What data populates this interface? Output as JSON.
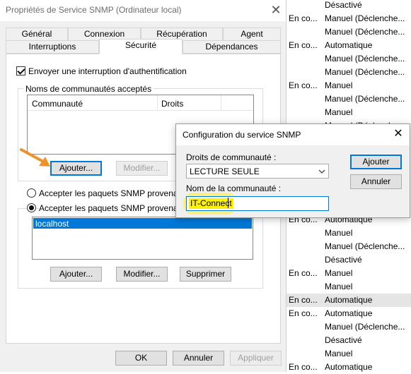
{
  "services": [
    {
      "status": "",
      "start": "Désactivé"
    },
    {
      "status": "En co...",
      "start": "Manuel (Déclenche..."
    },
    {
      "status": "",
      "start": "Manuel (Déclenche..."
    },
    {
      "status": "En co...",
      "start": "Automatique"
    },
    {
      "status": "",
      "start": "Manuel (Déclenche..."
    },
    {
      "status": "",
      "start": "Manuel (Déclenche..."
    },
    {
      "status": "En co...",
      "start": "Manuel"
    },
    {
      "status": "",
      "start": "Manuel (Déclenche..."
    },
    {
      "status": "",
      "start": "Manuel"
    },
    {
      "status": "",
      "start": "Manuel (Déclenche..."
    },
    {
      "status": "",
      "start": "Manuel (Déclenche..."
    },
    {
      "status": "",
      "start": "Manuel (Déclenche..."
    },
    {
      "status": "",
      "start": "Manuel (Déclenche..."
    },
    {
      "status": "",
      "start": "Manuel (Déclenche..."
    },
    {
      "status": "",
      "start": "Manuel (Déclenche..."
    },
    {
      "status": "",
      "start": "Manuel (Déclenche..."
    },
    {
      "status": "En co...",
      "start": "Automatique"
    },
    {
      "status": "",
      "start": "Manuel"
    },
    {
      "status": "",
      "start": "Manuel (Déclenche..."
    },
    {
      "status": "",
      "start": "Désactivé"
    },
    {
      "status": "En co...",
      "start": "Manuel"
    },
    {
      "status": "",
      "start": "Manuel"
    },
    {
      "status": "En co...",
      "start": "Automatique",
      "selected": true
    },
    {
      "status": "En co...",
      "start": "Automatique"
    },
    {
      "status": "",
      "start": "Manuel (Déclenche..."
    },
    {
      "status": "",
      "start": "Désactivé"
    },
    {
      "status": "",
      "start": "Manuel"
    },
    {
      "status": "En co...",
      "start": "Automatique"
    }
  ],
  "props": {
    "title": "Propriétés de Service SNMP (Ordinateur local)",
    "close_glyph": "✕",
    "tabs_row1": [
      "Général",
      "Connexion",
      "Récupération",
      "Agent"
    ],
    "tabs_row2": [
      "Interruptions",
      "Sécurité",
      "Dépendances"
    ],
    "active_tab": "Sécurité",
    "send_trap_label": "Envoyer une interruption d'authentification",
    "send_trap_checked": true,
    "communities_group": "Noms de communautés acceptés",
    "col_community": "Communauté",
    "col_rights": "Droits",
    "add_btn": "Ajouter...",
    "modify_btn": "Modifier...",
    "accept_any_label": "Accepter les paquets SNMP provenant d",
    "accept_hosts_label": "Accepter les paquets SNMP provenant d",
    "hosts": [
      "localhost"
    ],
    "hosts_add_btn": "Ajouter...",
    "hosts_modify_btn": "Modifier...",
    "hosts_delete_btn": "Supprimer",
    "ok_btn": "OK",
    "cancel_btn": "Annuler",
    "apply_btn": "Appliquer"
  },
  "dialog": {
    "title": "Configuration du service SNMP",
    "close_glyph": "✕",
    "rights_label": "Droits de communauté :",
    "rights_value": "LECTURE SEULE",
    "name_label": "Nom de la communauté :",
    "name_value": "IT-Connect",
    "add_btn": "Ajouter",
    "cancel_btn": "Annuler"
  },
  "colors": {
    "accent": "#0078d7",
    "highlight": "#fff100",
    "arrow": "#f0922b",
    "selection": "#0078d7"
  }
}
